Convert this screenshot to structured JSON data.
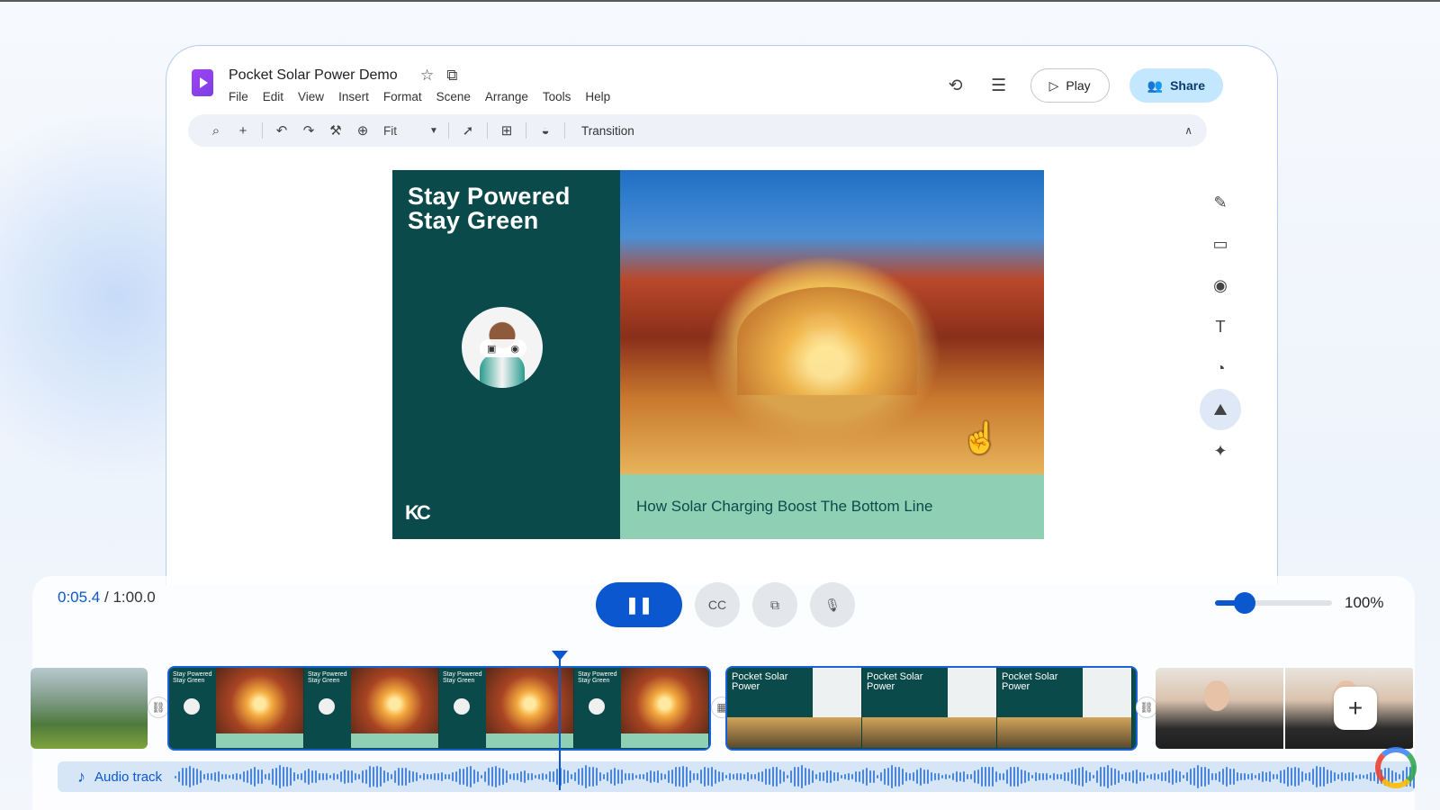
{
  "app": {
    "title": "Pocket Solar Power Demo",
    "menu": [
      "File",
      "Edit",
      "View",
      "Insert",
      "Format",
      "Scene",
      "Arrange",
      "Tools",
      "Help"
    ],
    "play_label": "Play",
    "share_label": "Share",
    "icons": {
      "logo": "vids-play-logo-icon",
      "star": "star-icon",
      "move": "folder-move-icon",
      "history": "history-icon",
      "comments": "comment-icon",
      "play": "play-icon",
      "share": "people-icon"
    }
  },
  "toolbar": {
    "zoom_label": "Fit",
    "transition_label": "Transition",
    "icons": [
      "search-icon",
      "add-icon",
      "undo-icon",
      "redo-icon",
      "paint-format-icon",
      "zoom-icon",
      "select-icon",
      "add-box-icon",
      "fill-icon",
      "collapse-icon"
    ]
  },
  "slide": {
    "heading": "Stay Powered\nStay Green",
    "caption": "How Solar Charging Boost The Bottom Line",
    "brand": "KC",
    "colors": {
      "panel": "#0b4a4a",
      "caption_bar": "#8fd0b4"
    }
  },
  "right_rail": {
    "icons": [
      "edit-note-icon",
      "folder-icon",
      "record-icon",
      "text-box-icon",
      "shapes-icon",
      "image-add-icon",
      "ai-image-icon"
    ],
    "active_index": 5
  },
  "player": {
    "current_time": "0:05.4",
    "total_time": "/ 1:00.0",
    "zoom_value": "100%",
    "zoom_fraction": 0.25,
    "controls": [
      "pause-icon",
      "captions-icon",
      "layout-icon",
      "voiceover-icon"
    ]
  },
  "timeline": {
    "scene_a": {
      "thumb_title": "Stay Powered Stay Green",
      "count": 4
    },
    "scene_b": {
      "thumb_title": "Pocket Solar Power",
      "count": 3
    },
    "audio_label": "Audio track",
    "add_label": "+"
  }
}
